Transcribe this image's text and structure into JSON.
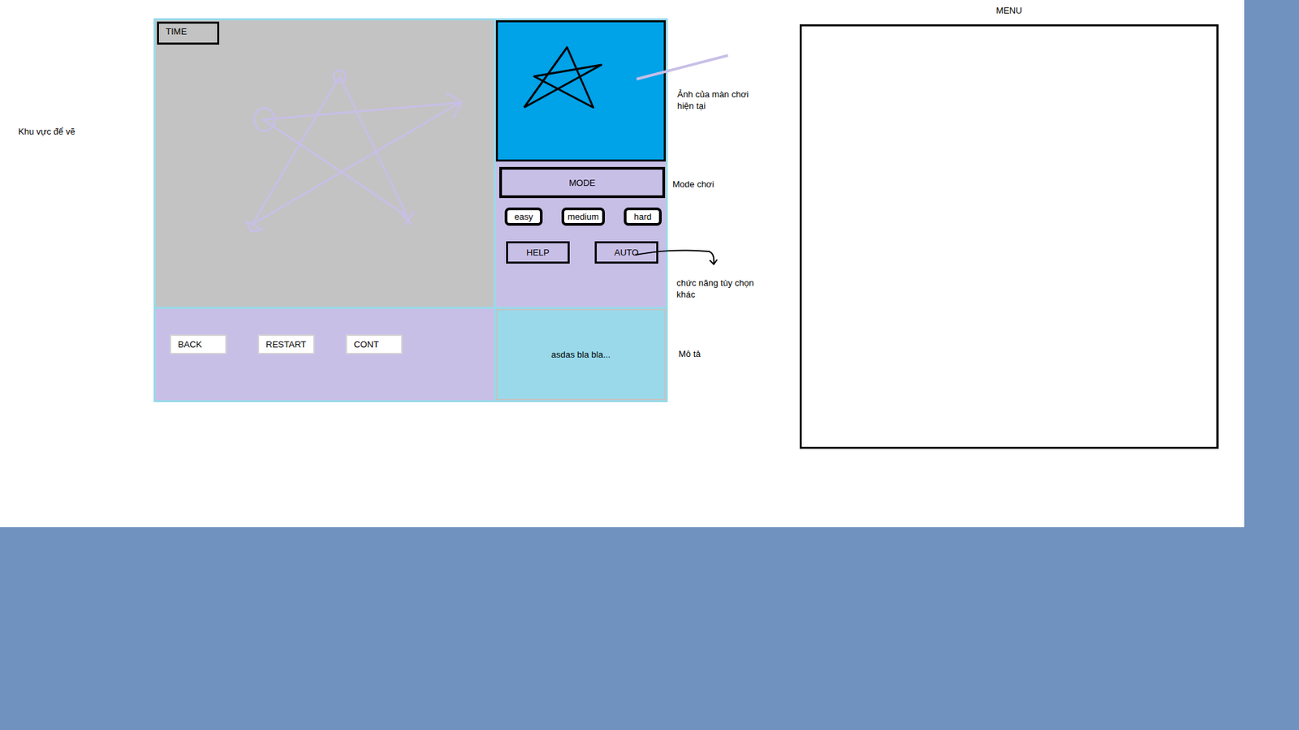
{
  "canvas": {
    "timer_label": "TIME",
    "label": "Khu vực để vẽ"
  },
  "preview": {
    "label": "Ảnh của màn chơi hiện tại"
  },
  "mode": {
    "title": "MODE",
    "label": "Mode chơi",
    "levels": [
      {
        "label": "easy",
        "selected": false
      },
      {
        "label": "medium",
        "selected": false
      },
      {
        "label": "hard",
        "selected": false
      }
    ]
  },
  "options": {
    "buttons": [
      "HELP",
      "AUTO"
    ],
    "label": "chức năng tùy chọn khác"
  },
  "controls": [
    "BACK",
    "RESTART",
    "CONT"
  ],
  "description": {
    "text": "asdas bla bla...",
    "label": "Mô tả"
  },
  "menu": {
    "title": "MENU"
  }
}
